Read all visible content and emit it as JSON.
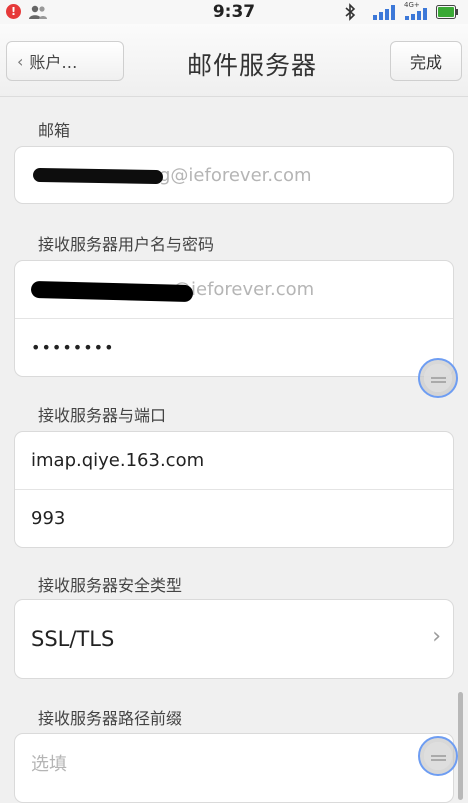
{
  "status_bar": {
    "notification_count": "!",
    "time": "9:37",
    "network_type": "4G+",
    "notification_icon": "alert-badge-icon",
    "contacts_icon": "contacts-icon",
    "bluetooth_icon": "bluetooth-icon",
    "battery_icon": "battery-icon",
    "battery_color": "#3aa935",
    "signal_color": "#3c78d8"
  },
  "nav": {
    "back_label": "账户…",
    "back_icon": "chevron-left-icon",
    "title": "邮件服务器",
    "done_label": "完成"
  },
  "form": {
    "email": {
      "label": "邮箱",
      "value_suffix": "g@ieforever.com"
    },
    "incoming_credentials": {
      "label": "接收服务器用户名与密码",
      "username_suffix": "@ieforever.com",
      "password": "••••••••"
    },
    "incoming_server": {
      "label": "接收服务器与端口",
      "host": "imap.qiye.163.com",
      "port": "993"
    },
    "security_type": {
      "label": "接收服务器安全类型",
      "value": "SSL/TLS",
      "chevron_icon": "chevron-right-icon"
    },
    "path_prefix": {
      "label": "接收服务器路径前缀",
      "placeholder": "选填"
    }
  },
  "accent_color": "#6e9df2"
}
